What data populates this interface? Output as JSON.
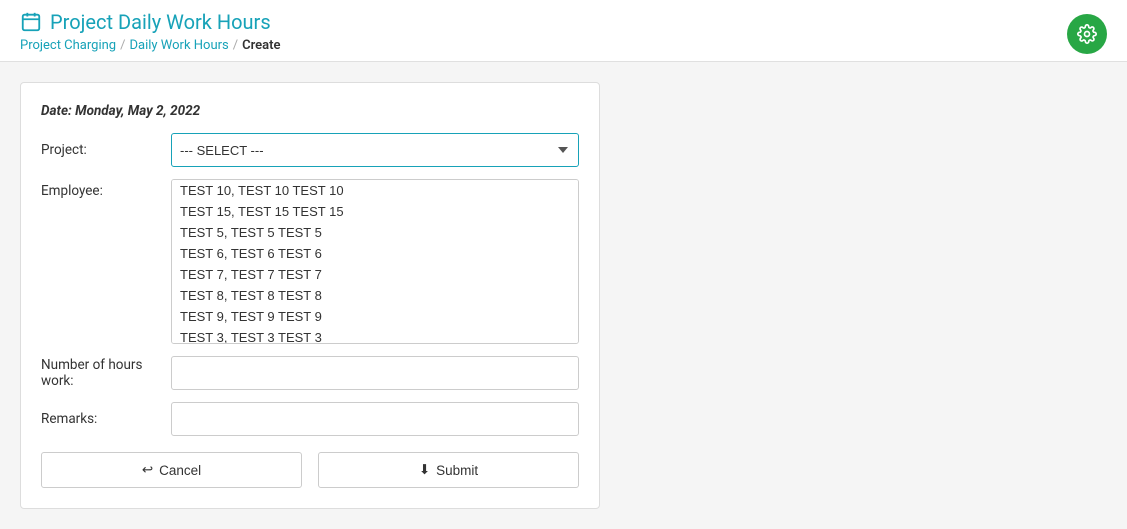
{
  "header": {
    "title": "Project Daily Work Hours",
    "icon": "calendar-icon",
    "breadcrumb": {
      "items": [
        {
          "label": "Project Charging",
          "link": true
        },
        {
          "label": "Daily Work Hours",
          "link": true
        },
        {
          "label": "Create",
          "link": false
        }
      ],
      "separators": [
        "/",
        "/"
      ]
    },
    "gear_button_label": "⚙"
  },
  "form": {
    "date_label": "Date: Monday, May 2, 2022",
    "project_label": "Project:",
    "project_placeholder": "--- SELECT ---",
    "project_options": [
      "--- SELECT ---"
    ],
    "employee_label": "Employee:",
    "employee_options": [
      "TEST 10, TEST 10 TEST 10",
      "TEST 15, TEST 15 TEST 15",
      "TEST 5, TEST 5 TEST 5",
      "TEST 6, TEST 6 TEST 6",
      "TEST 7, TEST 7 TEST 7",
      "TEST 8, TEST 8 TEST 8",
      "TEST 9, TEST 9 TEST 9",
      "TEST 3, TEST 3 TEST 3"
    ],
    "hours_label": "Number of hours work:",
    "hours_value": "",
    "remarks_label": "Remarks:",
    "remarks_value": "",
    "cancel_label": "Cancel",
    "cancel_icon": "↩",
    "submit_label": "Submit",
    "submit_icon": "⬇"
  }
}
